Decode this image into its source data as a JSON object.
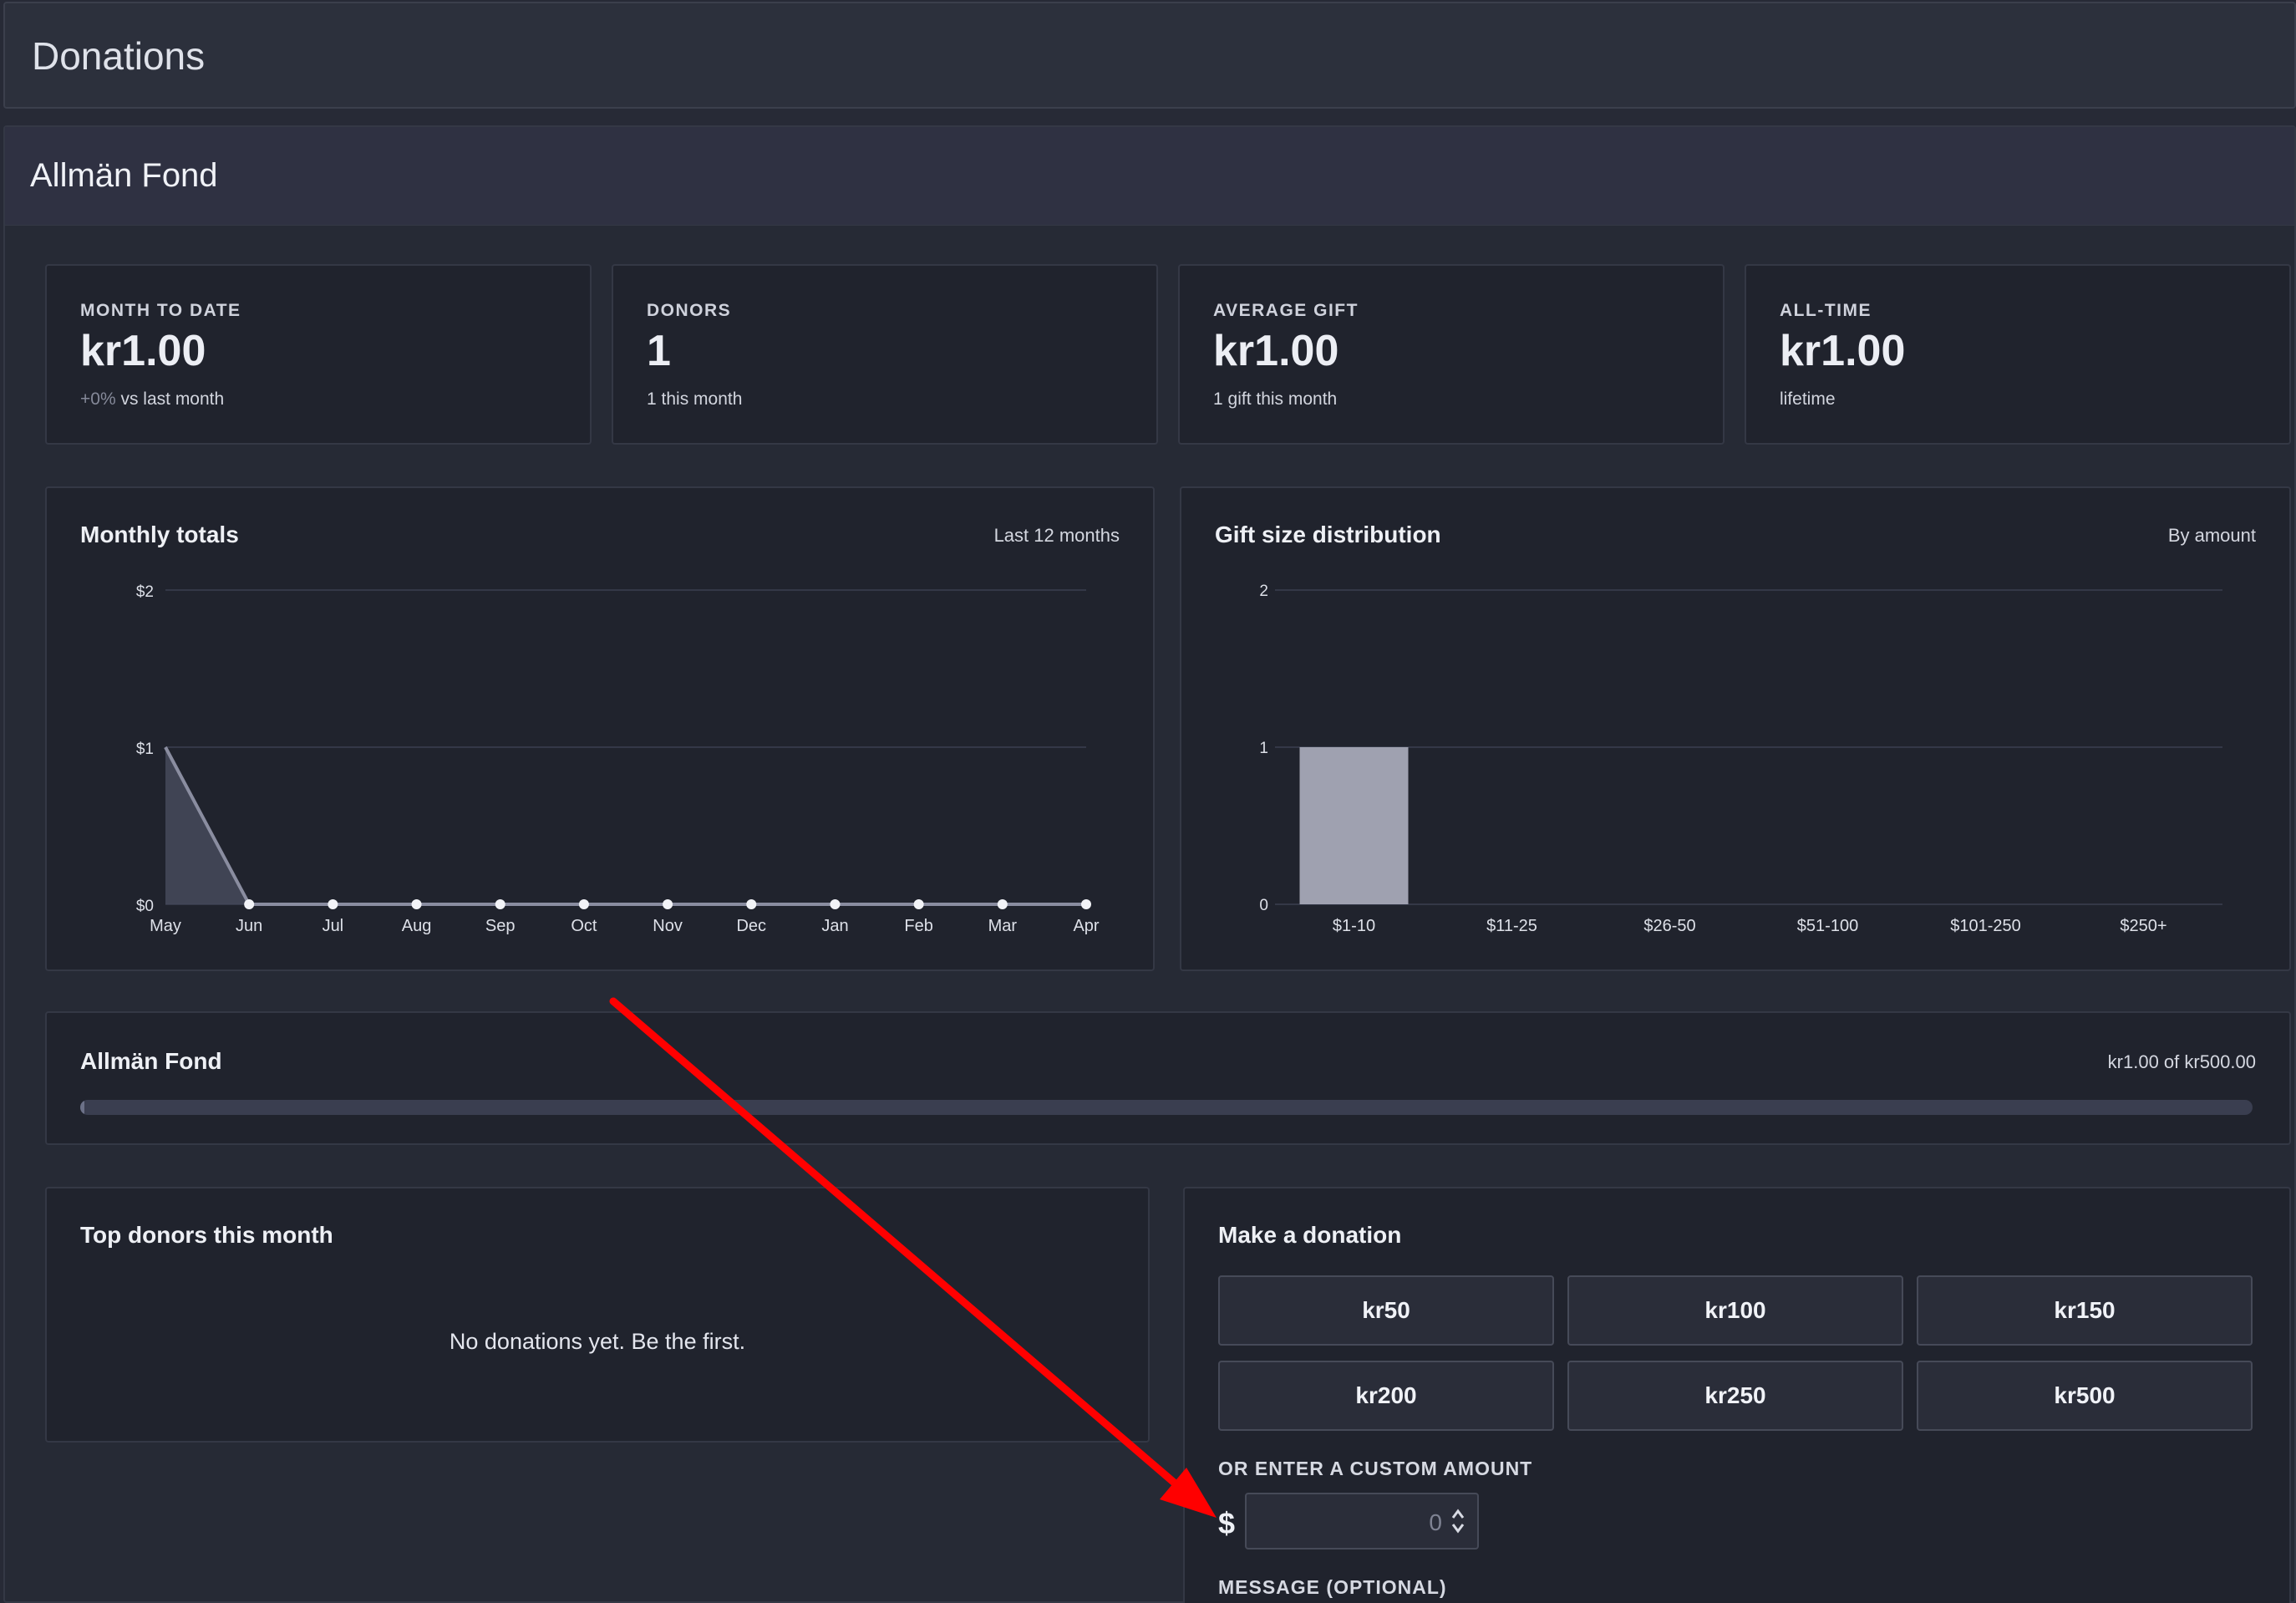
{
  "header": {
    "title": "Donations"
  },
  "fund": {
    "title": "Allmän Fond"
  },
  "stats": [
    {
      "label": "MONTH TO DATE",
      "value": "kr1.00",
      "sub_delta": "+0%",
      "sub_text": "vs last month"
    },
    {
      "label": "DONORS",
      "value": "1",
      "sub_text": "1 this month"
    },
    {
      "label": "AVERAGE GIFT",
      "value": "kr1.00",
      "sub_text": "1 gift this month"
    },
    {
      "label": "ALL-TIME",
      "value": "kr1.00",
      "sub_text": "lifetime"
    }
  ],
  "monthly_card": {
    "title": "Monthly totals",
    "meta": "Last 12 months"
  },
  "distribution_card": {
    "title": "Gift size distribution",
    "meta": "By amount"
  },
  "chart_data": [
    {
      "type": "line",
      "title": "Monthly totals",
      "x": [
        "May",
        "Jun",
        "Jul",
        "Aug",
        "Sep",
        "Oct",
        "Nov",
        "Dec",
        "Jan",
        "Feb",
        "Mar",
        "Apr"
      ],
      "y_tick_labels": [
        "$0",
        "$1",
        "$2"
      ],
      "series": [
        {
          "values": [
            1,
            0,
            0,
            0,
            0,
            0,
            0,
            0,
            0,
            0,
            0,
            0
          ]
        }
      ],
      "ylim": [
        0,
        2
      ],
      "grid": true,
      "fill": "area"
    },
    {
      "type": "bar",
      "title": "Gift size distribution",
      "categories": [
        "$1-10",
        "$11-25",
        "$26-50",
        "$51-100",
        "$101-250",
        "$250+"
      ],
      "values": [
        1,
        0,
        0,
        0,
        0,
        0
      ],
      "y_tick_labels": [
        "0",
        "1",
        "2"
      ],
      "ylim": [
        0,
        2
      ],
      "grid": true,
      "bar_color": "#9fa1b0"
    }
  ],
  "goal": {
    "title": "Allmän Fond",
    "summary": "kr1.00 of kr500.00",
    "raised": 1,
    "target": 500
  },
  "top_donors": {
    "title": "Top donors this month",
    "empty_message": "No donations yet. Be the first."
  },
  "donate": {
    "title": "Make a donation",
    "amounts": [
      "kr50",
      "kr100",
      "kr150",
      "kr200",
      "kr250",
      "kr500"
    ],
    "custom_label": "OR ENTER A CUSTOM AMOUNT",
    "currency_symbol": "$",
    "custom_value": "0",
    "message_label": "MESSAGE (OPTIONAL)"
  },
  "colors": {
    "background": "#272a36",
    "card": "#20232d",
    "annotation_arrow": "#ff0000",
    "bar": "#9fa1b0",
    "line": "#8a8da0"
  }
}
